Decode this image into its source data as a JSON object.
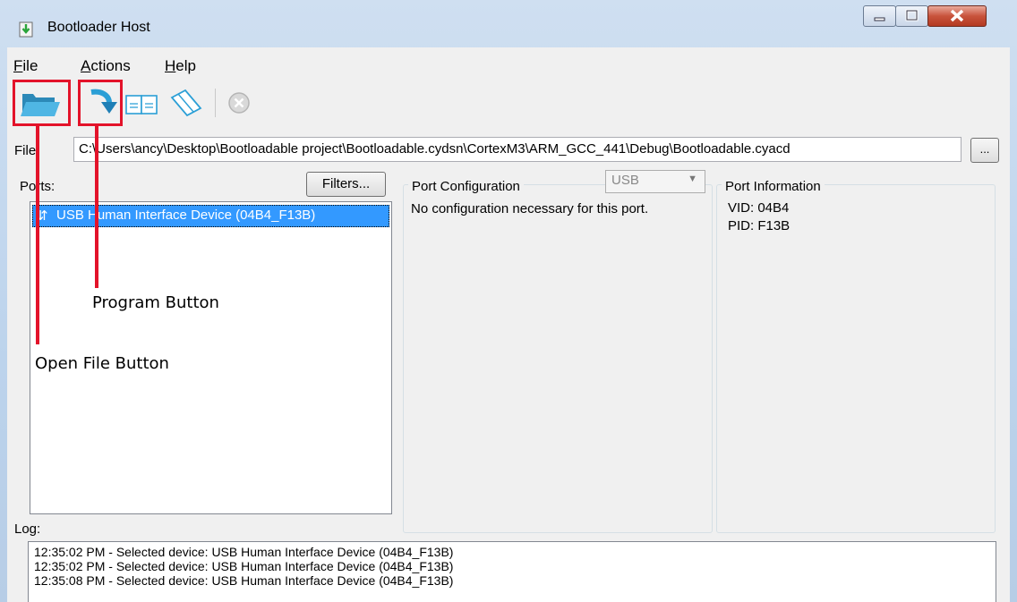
{
  "window": {
    "title": "Bootloader Host"
  },
  "menubar": {
    "items": [
      {
        "label": "File",
        "accel": "F",
        "rest": "ile"
      },
      {
        "label": "Actions",
        "accel": "A",
        "rest": "ctions"
      },
      {
        "label": "Help",
        "accel": "H",
        "rest": "elp"
      }
    ]
  },
  "toolbar": {
    "icons": [
      "folder-open-icon",
      "program-arrow-icon",
      "verify-icon",
      "erase-icon",
      "abort-icon"
    ]
  },
  "file": {
    "label": "File:",
    "path": "C:\\Users\\ancy\\Desktop\\Bootloadable project\\Bootloadable.cydsn\\CortexM3\\ARM_GCC_441\\Debug\\Bootloadable.cyacd",
    "browse_label": "..."
  },
  "ports": {
    "label": "Ports:",
    "filters_label": "Filters...",
    "items": [
      "USB Human Interface Device (04B4_F13B)"
    ]
  },
  "port_config": {
    "title": "Port Configuration",
    "protocol": "USB",
    "message": "No configuration necessary for this port."
  },
  "port_info": {
    "title": "Port Information",
    "vid": "VID: 04B4",
    "pid": "PID: F13B"
  },
  "log": {
    "label": "Log:",
    "lines": [
      "12:35:02 PM - Selected device: USB Human Interface Device (04B4_F13B)",
      "12:35:02 PM - Selected device: USB Human Interface Device (04B4_F13B)",
      "12:35:08 PM - Selected device: USB Human Interface Device (04B4_F13B)"
    ]
  },
  "annotations": {
    "program_button": "Program Button",
    "open_file_button": "Open File Button"
  },
  "colors": {
    "highlight": "#e3132a",
    "selection": "#3399ff"
  }
}
